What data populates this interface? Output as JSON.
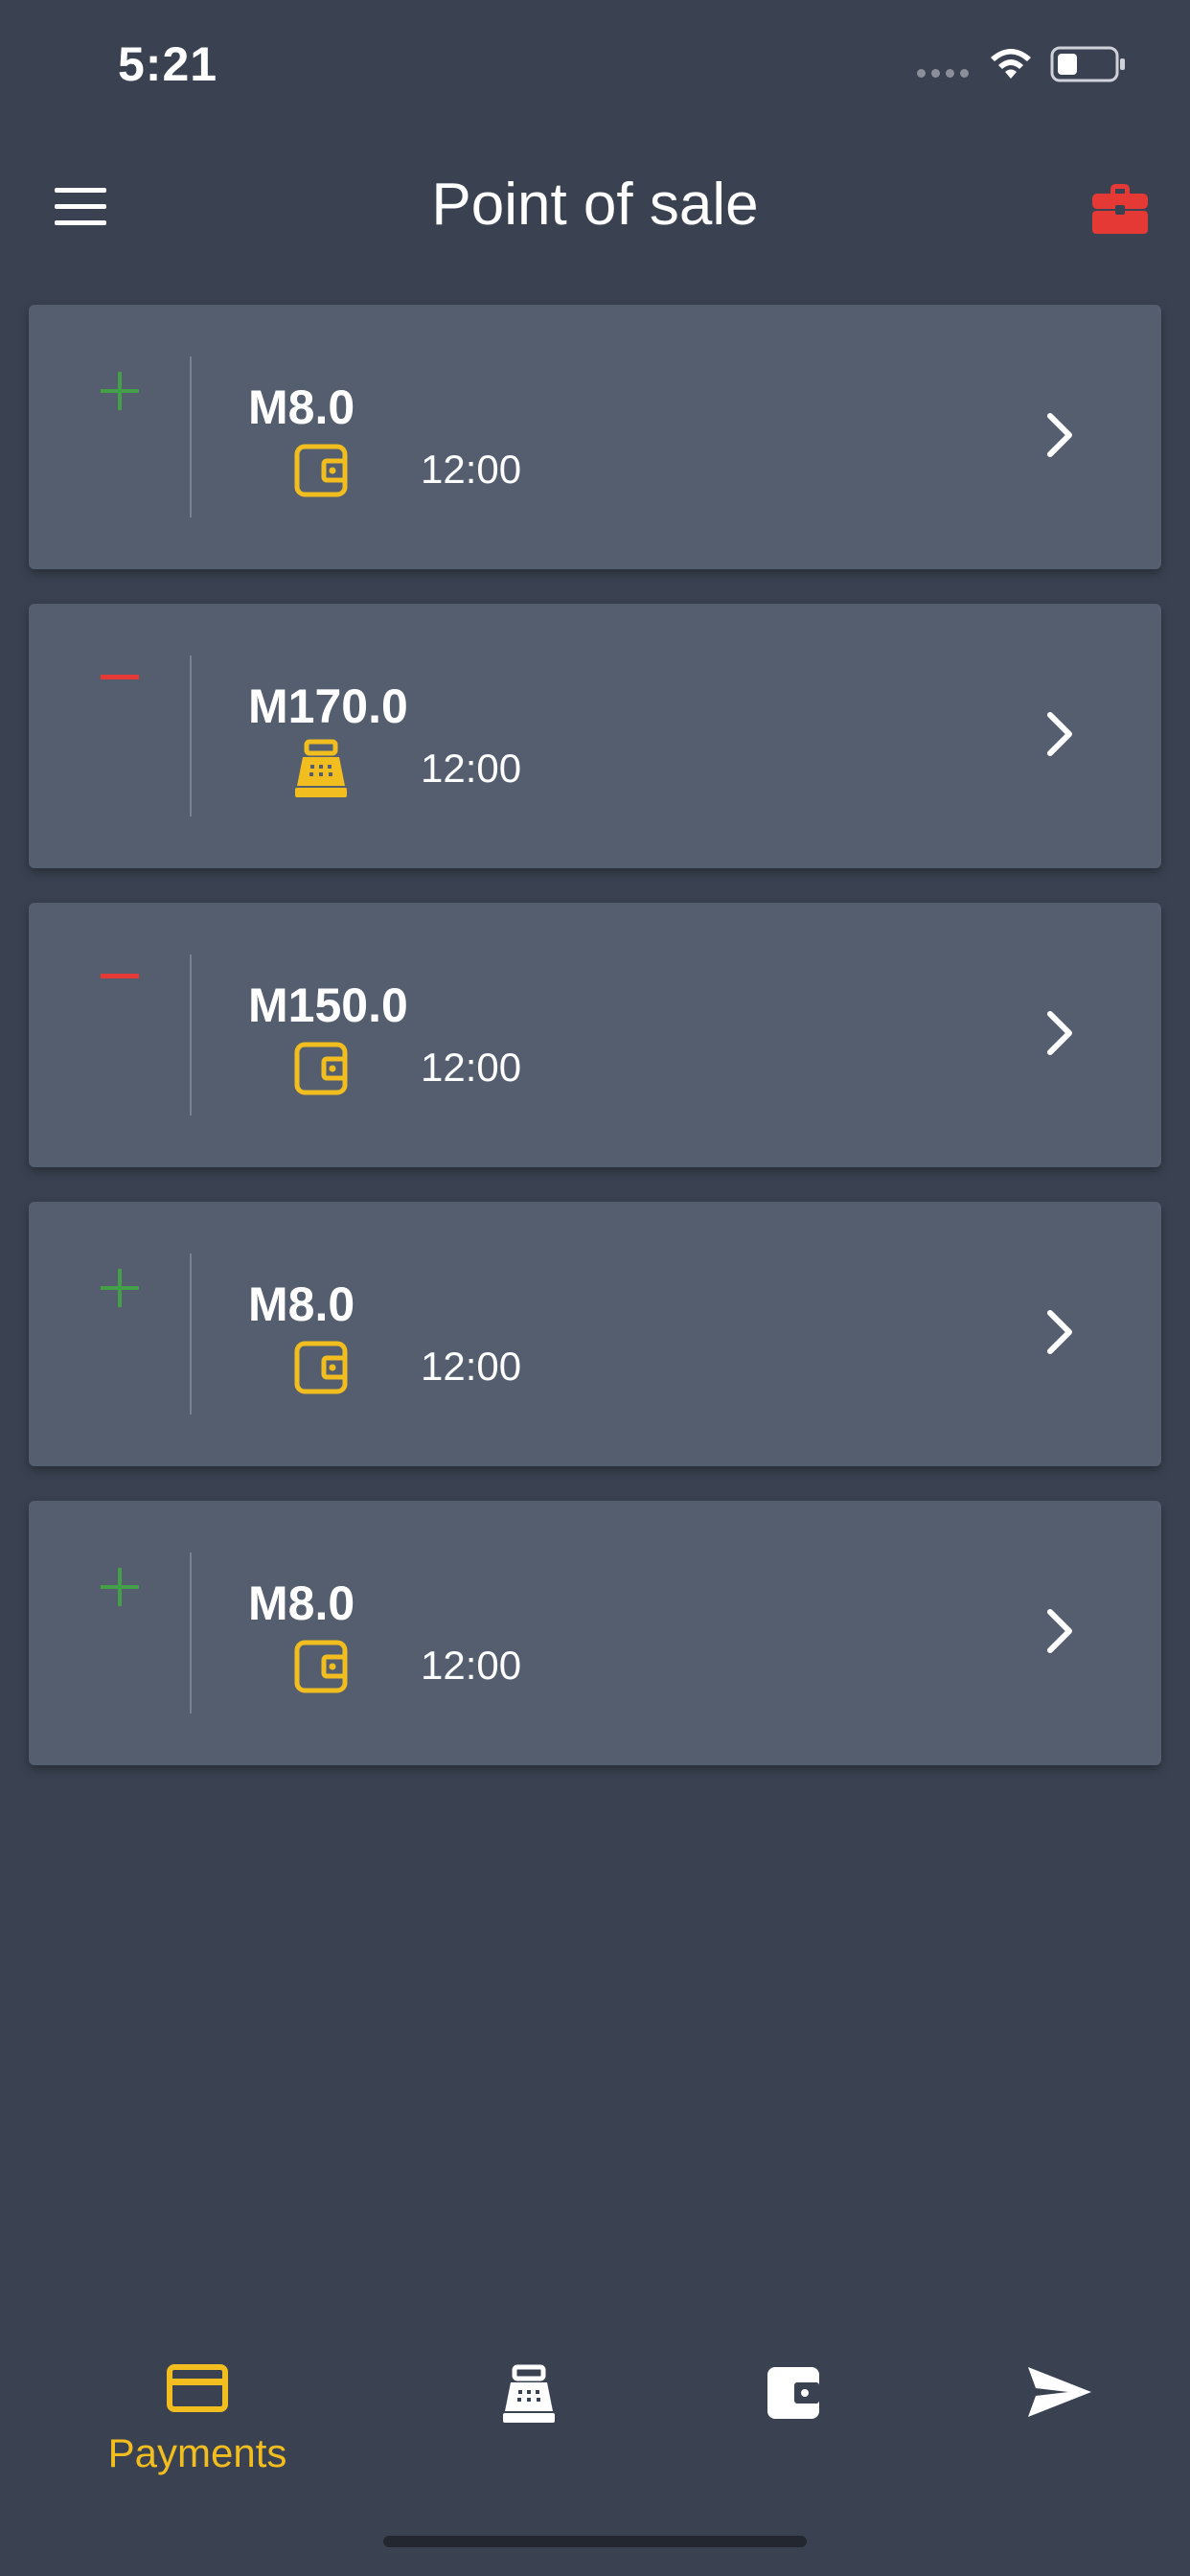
{
  "status_bar": {
    "time": "5:21"
  },
  "header": {
    "title": "Point of sale"
  },
  "colors": {
    "accent": "#f1bd1f",
    "positive": "#43a047",
    "negative": "#e53935",
    "briefcase": "#e53935"
  },
  "transactions": [
    {
      "sign": "plus",
      "amount": "M8.0",
      "type_icon": "wallet-icon",
      "time": "12:00"
    },
    {
      "sign": "minus",
      "amount": "M170.0",
      "type_icon": "cash-register-icon",
      "time": "12:00"
    },
    {
      "sign": "minus",
      "amount": "M150.0",
      "type_icon": "wallet-icon",
      "time": "12:00"
    },
    {
      "sign": "plus",
      "amount": "M8.0",
      "type_icon": "wallet-icon",
      "time": "12:00"
    },
    {
      "sign": "plus",
      "amount": "M8.0",
      "type_icon": "wallet-icon",
      "time": "12:00"
    }
  ],
  "bottom_nav": {
    "items": [
      {
        "label": "Payments",
        "icon": "credit-card-icon",
        "active": true
      },
      {
        "label": "",
        "icon": "cash-register-icon",
        "active": false
      },
      {
        "label": "",
        "icon": "wallet-icon",
        "active": false
      },
      {
        "label": "",
        "icon": "send-icon",
        "active": false
      }
    ]
  }
}
